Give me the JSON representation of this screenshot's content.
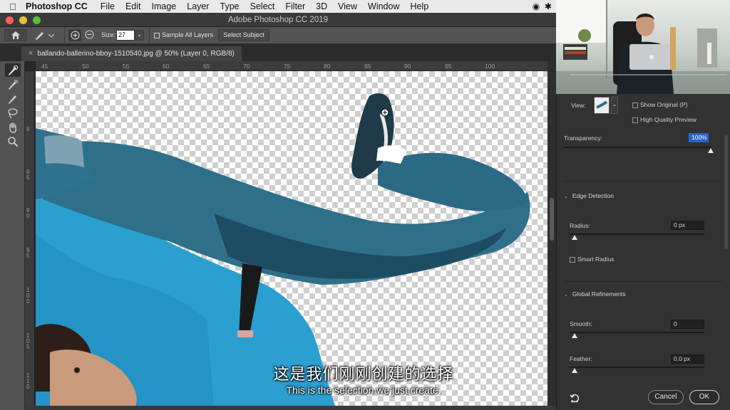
{
  "menubar": {
    "app_name": "Photoshop CC",
    "items": [
      "File",
      "Edit",
      "Image",
      "Layer",
      "Type",
      "Select",
      "Filter",
      "3D",
      "View",
      "Window",
      "Help"
    ]
  },
  "window": {
    "title": "Adobe Photoshop CC 2019"
  },
  "options": {
    "size_label": "Size:",
    "size_value": "27",
    "sample_all_layers": "Sample All Layers",
    "select_subject": "Select Subject"
  },
  "document": {
    "tab_title": "ballando-ballerino-bboy-1510540.jpg @ 50% (Layer 0, RGB/8)"
  },
  "ruler": {
    "top": [
      "45",
      "50",
      "55",
      "60",
      "65",
      "70",
      "75",
      "80",
      "85",
      "90",
      "95",
      "100"
    ],
    "left": [
      "8",
      "85",
      "90",
      "95",
      "100",
      "105",
      "110"
    ]
  },
  "panel": {
    "view_label": "View:",
    "show_original": "Show Original (P)",
    "high_quality_preview": "High Quality Preview",
    "transparency_label": "Transparency:",
    "transparency_value": "100%",
    "transparency_level": 1.0,
    "edge_detection_title": "Edge Detection",
    "radius_label": "Radius:",
    "radius_value": "0 px",
    "smart_radius": "Smart Radius",
    "global_refinements_title": "Global Refinements",
    "smooth_label": "Smooth:",
    "smooth_value": "0",
    "feather_label": "Feather:",
    "feather_value": "0,0 px",
    "cancel_label": "Cancel",
    "ok_label": "OK"
  },
  "subtitles": {
    "chinese": "这是我们刚刚创建的选择",
    "english": "This is the selection we just create."
  },
  "colors": {
    "accent_selection": "#2f62c2",
    "shirt_blue": "#2a9fd0",
    "jeans_blue": "#2e6f8a"
  }
}
